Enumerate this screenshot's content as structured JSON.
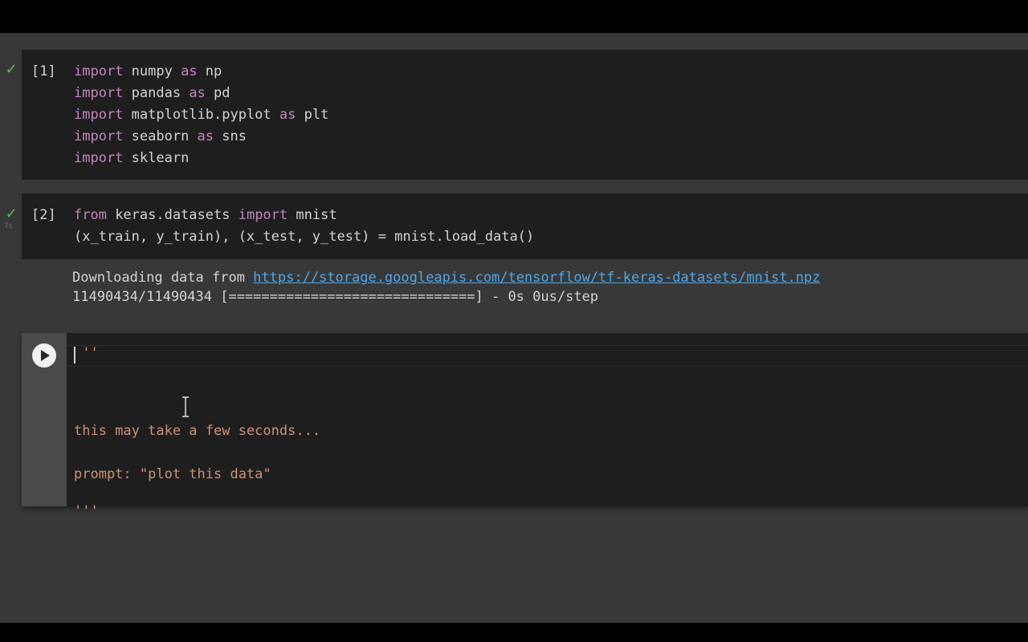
{
  "cells": [
    {
      "prompt": "[1]",
      "status_icon": "check-icon",
      "lines": [
        {
          "kw": "import",
          "rest": " numpy "
        },
        {
          "kw": "import",
          "rest": " pandas "
        },
        {
          "kw": "import",
          "rest": " matplotlib.pyplot "
        },
        {
          "kw": "import",
          "rest": " seaborn "
        },
        {
          "kw": "import",
          "rest": " sklearn"
        }
      ],
      "aliases": [
        {
          "as": "as",
          "name": " np"
        },
        {
          "as": "as",
          "name": " pd"
        },
        {
          "as": "as",
          "name": " plt"
        },
        {
          "as": "as",
          "name": " sns"
        }
      ]
    },
    {
      "prompt": "[2]",
      "status_icon": "check-icon",
      "exec_time": "7s",
      "line1": {
        "from": "from",
        "module": " keras.datasets ",
        "import": "import",
        "name": " mnist"
      },
      "line2": "(x_train, y_train), (x_test, y_test) = mnist.load_data()",
      "output": {
        "prefix": "Downloading data from ",
        "url": "https://storage.googleapis.com/tensorflow/tf-keras-datasets/mnist.npz",
        "progress": "11490434/11490434 [==============================] - 0s 0us/step"
      }
    },
    {
      "run_icon": "play-icon",
      "lines": [
        "'''",
        "this may take a few seconds...",
        "prompt: \"plot this data\"",
        "'''"
      ],
      "first_line_tail": "''"
    }
  ]
}
